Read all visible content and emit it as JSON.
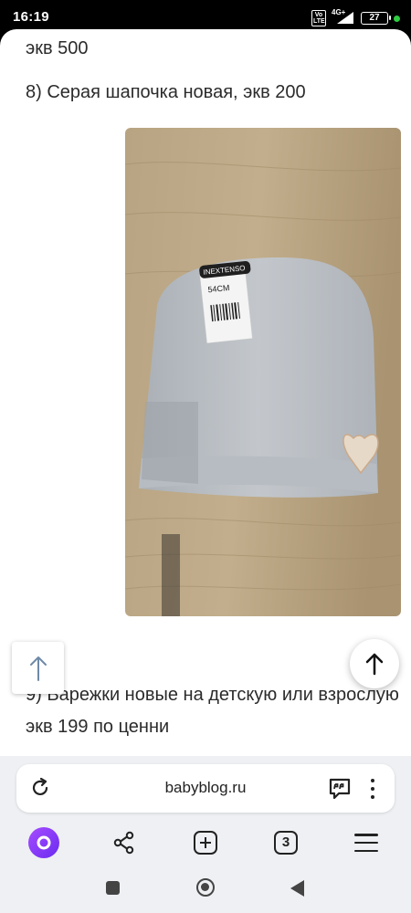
{
  "status_bar": {
    "time": "16:19",
    "volte": "Vo LTE",
    "network": "4G+",
    "battery": "27"
  },
  "article": {
    "line_prev_tail": "экв 500",
    "item_8": "8) Серая шапочка новая, экв 200",
    "item_9": "9) Варежки новые на детскую или взрослую",
    "item_9_tail": "экв 199 по ценни",
    "photo_tag_brand": "INEXTENSO",
    "photo_tag_size": "54CM"
  },
  "browser": {
    "url": "babyblog.ru"
  },
  "toolbar": {
    "tabs_count": "3"
  },
  "colors": {
    "alice_accent": "#8a3ffc",
    "hat": "#b9bec4",
    "wood": "#b59f7d"
  }
}
